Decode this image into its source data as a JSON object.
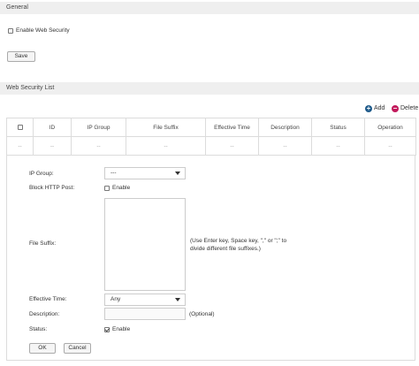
{
  "general": {
    "header": "General",
    "enable_label": "Enable Web Security",
    "save_label": "Save"
  },
  "list": {
    "header": "Web Security List",
    "add_label": "Add",
    "delete_label": "Delete",
    "columns": [
      "ID",
      "IP Group",
      "File Suffix",
      "Effective Time",
      "Description",
      "Status",
      "Operation"
    ],
    "empty_cell": "--"
  },
  "form": {
    "ip_group_label": "IP Group:",
    "ip_group_value": "---",
    "block_http_post_label": "Block HTTP Post:",
    "block_http_post_option": "Enable",
    "file_suffix_label": "File Suffix:",
    "file_suffix_hint_line1": "(Use Enter key, Space key, \",\" or \";\" to",
    "file_suffix_hint_line2": "divide different file suffixes.)",
    "effective_time_label": "Effective Time:",
    "effective_time_value": "Any",
    "description_label": "Description:",
    "description_hint": "(Optional)",
    "status_label": "Status:",
    "status_option": "Enable",
    "ok_label": "OK",
    "cancel_label": "Cancel"
  },
  "colors": {
    "add_icon": "#1e5a8a",
    "delete_icon": "#c2185b"
  }
}
